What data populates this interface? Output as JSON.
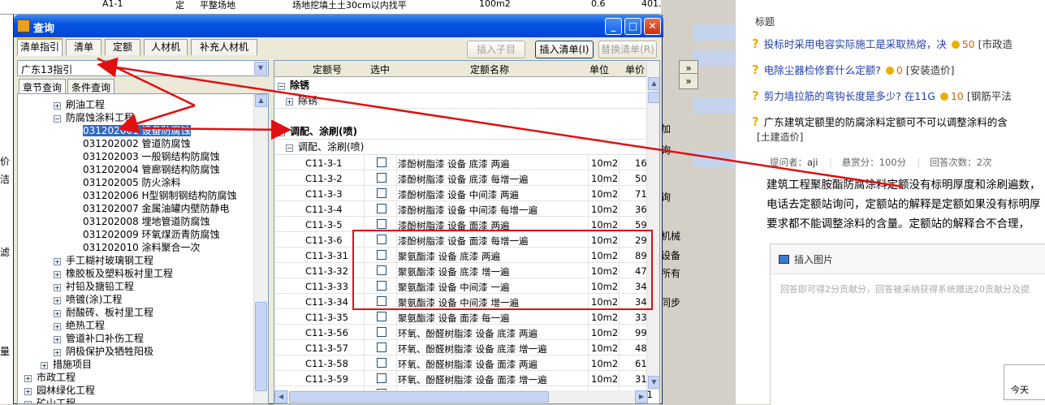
{
  "background": {
    "top_row": {
      "code": "A1-1",
      "flag": "定",
      "name": "平整场地",
      "desc": "场地挖填土土30cm以内找平",
      "unit": "100m2",
      "q1": "0.6",
      "q2": "401.9"
    },
    "left_fragments": [
      "价",
      "洁",
      "滤",
      "量"
    ],
    "mid_fragments": [
      "加",
      "询",
      "询",
      "机械",
      "设备",
      "所有",
      "同步"
    ],
    "mid_buttons": [
      "»",
      "»"
    ]
  },
  "qa_panel": {
    "header": "标题",
    "questions": [
      {
        "title": "投标时采用电容实际施工是采取热熔，决",
        "points": "50",
        "category": "[市政造"
      },
      {
        "title": "电除尘器检修套什么定额?",
        "points": "0",
        "category": "[安装造价]"
      },
      {
        "title": "剪力墙拉筋的弯钩长度是多少? 在11G",
        "points": "10",
        "category": "[钢筋平法"
      },
      {
        "title": "广东建筑定额里的防腐涂料定额可不可以调整涂料的含",
        "points": "",
        "category": ""
      }
    ],
    "tag": "[土建造价]",
    "asker_label": "提问者：",
    "asker": "aji",
    "reward": "悬赏分：100分",
    "answers": "回答次数：2次",
    "body_lines": [
      "建筑工程聚胺酯防腐涂料定额没有标明厚度和涂刷遍数，",
      "电话去定额站询问，定额站的解释是定额如果没有标明厚",
      "要求都不能调整涂料的含量。定额站的解释合不合理，"
    ],
    "insert_image": "插入图片",
    "answer_placeholder": "回答即可得2分贡献分，回答被采纳获得系统赠送20贡献分及提",
    "popup_text": "今天"
  },
  "dialog": {
    "title": "查询",
    "tabs": [
      "清单指引",
      "清单",
      "定额",
      "人材机",
      "补充人材机"
    ],
    "buttons": {
      "insert_child": "插入子目",
      "insert_list": "插入清单(I)",
      "replace_list": "替换清单(R)"
    },
    "combo_value": "广东13指引",
    "subtabs": [
      "章节查询",
      "条件查询"
    ],
    "tree": [
      {
        "label": "刷油工程",
        "pm": "+",
        "level": 2
      },
      {
        "label": "防腐蚀涂料工程",
        "pm": "−",
        "level": 2
      },
      {
        "label": "031202001  设备防腐蚀",
        "pm": "",
        "level": 3,
        "selected": true
      },
      {
        "label": "031202002  管道防腐蚀",
        "pm": "",
        "level": 3
      },
      {
        "label": "031202003  一般钢结构防腐蚀",
        "pm": "",
        "level": 3
      },
      {
        "label": "031202004  管廊钢结构防腐蚀",
        "pm": "",
        "level": 3
      },
      {
        "label": "031202005  防火涂料",
        "pm": "",
        "level": 3
      },
      {
        "label": "031202006  H型钢制钢结构防腐蚀",
        "pm": "",
        "level": 3
      },
      {
        "label": "031202007  金属油罐内壁防静电",
        "pm": "",
        "level": 3
      },
      {
        "label": "031202008  埋地管道防腐蚀",
        "pm": "",
        "level": 3
      },
      {
        "label": "031202009  环氧煤沥青防腐蚀",
        "pm": "",
        "level": 3
      },
      {
        "label": "031202010  涂料聚合一次",
        "pm": "",
        "level": 3
      },
      {
        "label": "手工糊衬玻璃钢工程",
        "pm": "+",
        "level": 2
      },
      {
        "label": "橡胶板及塑料板衬里工程",
        "pm": "+",
        "level": 2
      },
      {
        "label": "衬铅及搪铅工程",
        "pm": "+",
        "level": 2
      },
      {
        "label": "喷镀(涂)工程",
        "pm": "+",
        "level": 2
      },
      {
        "label": "耐酸砖、板衬里工程",
        "pm": "+",
        "level": 2
      },
      {
        "label": "绝热工程",
        "pm": "+",
        "level": 2
      },
      {
        "label": "管道补口补伤工程",
        "pm": "+",
        "level": 2
      },
      {
        "label": "阴极保护及牺牲阳极",
        "pm": "+",
        "level": 2
      },
      {
        "label": "措施项目",
        "pm": "+",
        "level": 1
      },
      {
        "label": "市政工程",
        "pm": "+",
        "level": 0
      },
      {
        "label": "园林绿化工程",
        "pm": "+",
        "level": 0
      },
      {
        "label": "矿山工程",
        "pm": "+",
        "level": 0
      }
    ],
    "grid_headers": [
      "定额号",
      "选中",
      "定额名称",
      "单位",
      "单价"
    ],
    "groups": [
      {
        "label": "除锈",
        "pm": "−"
      },
      {
        "label": "除锈",
        "pm": "+",
        "sub": true
      },
      {
        "label": "调配、涂刷(喷)",
        "pm": "−"
      },
      {
        "label": "调配、涂刷(喷)",
        "pm": "−",
        "sub": true
      }
    ],
    "rows": [
      {
        "code": "C11-3-1",
        "name": "漆酚树脂漆 设备 底漆 两遍",
        "unit": "10m2",
        "price": "16"
      },
      {
        "code": "C11-3-2",
        "name": "漆酚树脂漆 设备 底漆 每增一遍",
        "unit": "10m2",
        "price": "50"
      },
      {
        "code": "C11-3-3",
        "name": "漆酚树脂漆 设备 中间漆 两遍",
        "unit": "10m2",
        "price": "71"
      },
      {
        "code": "C11-3-4",
        "name": "漆酚树脂漆 设备 中间漆 每增一遍",
        "unit": "10m2",
        "price": "36"
      },
      {
        "code": "C11-3-5",
        "name": "漆酚树脂漆 设备 面漆 两遍",
        "unit": "10m2",
        "price": "59"
      },
      {
        "code": "C11-3-6",
        "name": "漆酚树脂漆 设备 面漆 每增一遍",
        "unit": "10m2",
        "price": "29"
      },
      {
        "code": "C11-3-31",
        "name": "聚氨酯漆 设备 底漆 两遍",
        "unit": "10m2",
        "price": "89"
      },
      {
        "code": "C11-3-32",
        "name": "聚氨酯漆 设备 底漆 增一遍",
        "unit": "10m2",
        "price": "47"
      },
      {
        "code": "C11-3-33",
        "name": "聚氨酯漆 设备 中间漆 一遍",
        "unit": "10m2",
        "price": "34"
      },
      {
        "code": "C11-3-34",
        "name": "聚氨酯漆 设备 中间漆 增一遍",
        "unit": "10m2",
        "price": "34"
      },
      {
        "code": "C11-3-35",
        "name": "聚氨酯漆 设备 面漆 每一遍",
        "unit": "10m2",
        "price": "33"
      },
      {
        "code": "C11-3-56",
        "name": "环氧、酚醛树脂漆 设备 底漆 两遍",
        "unit": "10m2",
        "price": "99"
      },
      {
        "code": "C11-3-57",
        "name": "环氧、酚醛树脂漆 设备 底漆 增一遍",
        "unit": "10m2",
        "price": "48"
      },
      {
        "code": "C11-3-58",
        "name": "环氧、酚醛树脂漆 设备 面漆 两遍",
        "unit": "10m2",
        "price": "61"
      },
      {
        "code": "C11-3-59",
        "name": "环氧、酚醛树脂漆 设备 面漆 增一遍",
        "unit": "10m2",
        "price": "31"
      },
      {
        "code": "C11-3-80",
        "name": "冷固环氧树脂漆 设备 底漆 两遍",
        "unit": "10m2",
        "price": "101"
      }
    ],
    "accent": "#0854e0",
    "highlight": "#e01010"
  }
}
